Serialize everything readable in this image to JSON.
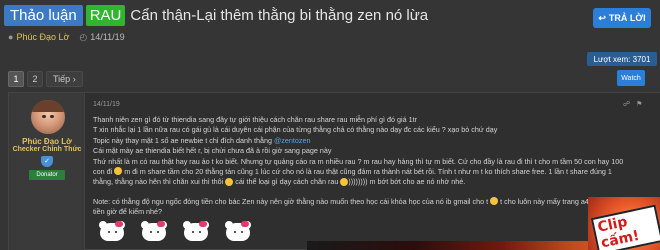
{
  "thread": {
    "prefix_1": "Thảo luận",
    "prefix_2": "RAU",
    "title": "Cẩn thận-Lại thêm thằng bi thằng zen nó lừa",
    "author": "Phúc Đạo Lờ",
    "date": "14/11/19"
  },
  "actions": {
    "reply_label": "TRẢ LỜI",
    "views_label": "Lượt xem: 3701",
    "watch_label": "Watch"
  },
  "pagination": {
    "pages": [
      "1",
      "2"
    ],
    "active_page": "1",
    "next_label": "Tiếp"
  },
  "post": {
    "date": "14/11/19",
    "user": {
      "name": "Phúc Đạo Lờ",
      "title": "Checker Chính Thức",
      "badge": "Donator"
    },
    "lines": [
      "Thanh niên zen gì đó từ thiendia sang đây tự giới thiệu cách chăn rau share rau miễn phí gì đó giá 1tr",
      "T xin nhắc lại 1 lần nữa rau có gái gủ là cái duyên cái phận của từng thằng chả có thằng nào dạy đc các kiểu ? xạo bò chứ dạy",
      "Topic này thay mặt 1 số ae newbie t chỉ đích danh thằng",
      "Cái mặt mày ae thiendia biết hết r, bị chửi chưa đã à rồi giờ sang page này",
      "Thứ nhất là m có rau thật hay rau ảo t ko biết. Nhưng tự quảng cáo ra m nhiều rau ? m rau hay hàng thì tự m biết. Cứ cho đầy là rau đi thì t cho m tầm 50 con hay 100",
      "con đi",
      "m đi m share tầm cho 20 thằng tán cũng 1 lúc cứ cho nó là rau thật cũng đảm ra thành nát bét rồi. Tính t như m t ko thích share free. 1 lần t share đúng 1",
      "thằng, thằng nào hên thì chăn xui thì thôi",
      "cái thể loại gì dạy cách chăn rau",
      "m bớt bớt cho ae nó nhờ nhé."
    ],
    "mention": "@zentozen",
    "note_1": "Note: có thằng độ ngu ngốc đóng tiền cho bác Zen này nên giờ thằng nào muốn theo học cái khóa học của nó ib gmail cho t",
    "note_1b": "t cho luôn này mấy trang a4 bán 1 tr",
    "note_2": "tiền giờ để kiếm nhé?",
    "sticker_text": "Clip cấm!"
  }
}
